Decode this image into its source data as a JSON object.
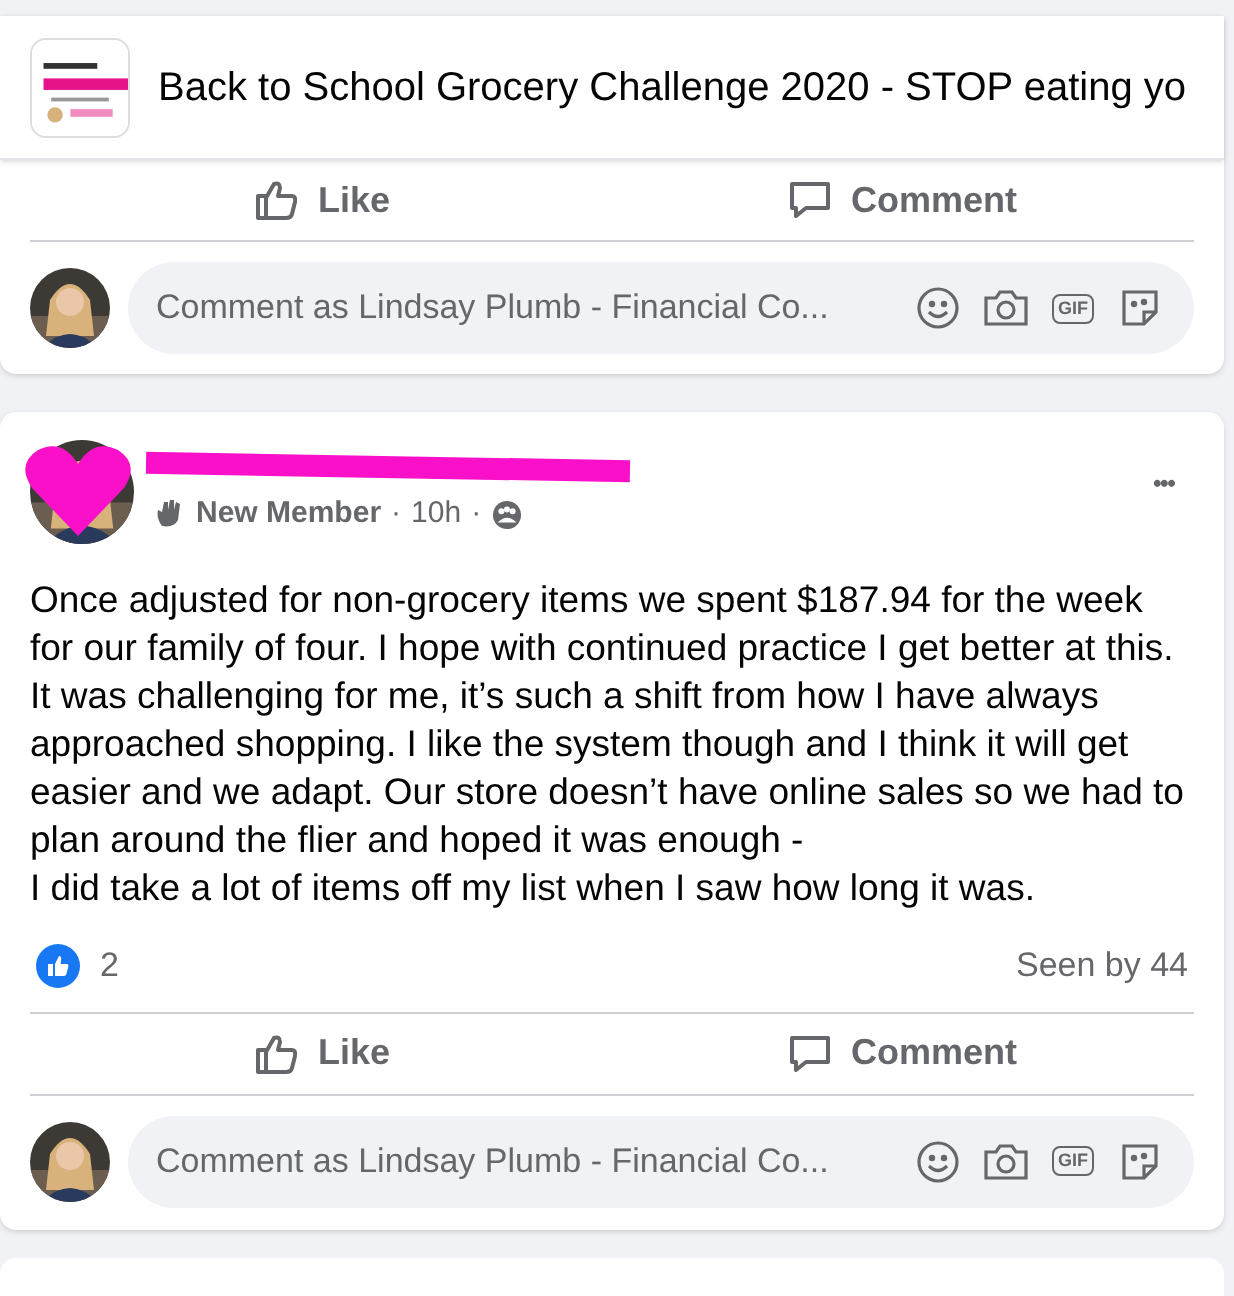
{
  "group_header": {
    "title": "Back to School Grocery Challenge 2020 - STOP eating yo"
  },
  "posts": [
    {
      "actions": [
        {
          "label": "Like",
          "kind": "like"
        },
        {
          "label": "Comment",
          "kind": "comment"
        }
      ],
      "comment_box": {
        "placeholder": "Comment as Lindsay Plumb - Financial Co...",
        "gif_label": "GIF"
      }
    },
    {
      "author": {
        "redacted": true,
        "badge": "New Member",
        "time": "10h",
        "separator": "·"
      },
      "more": "•••",
      "body": "Once adjusted for non-grocery items we spent $187.94 for the week for our family of four. I hope with continued practice I get better at this. It was challenging for me, it’s such a shift from how I have always approached shopping. I like the system though and I think it will get easier and we adapt.  Our store doesn’t have online sales so we had to plan around the flier and hoped it was enough -\nI did take a lot of items off my list when I saw how long it was.",
      "reactions": {
        "count": "2",
        "seen": "Seen by 44"
      },
      "actions": [
        {
          "label": "Like",
          "kind": "like"
        },
        {
          "label": "Comment",
          "kind": "comment"
        }
      ],
      "comment_box": {
        "placeholder": "Comment as Lindsay Plumb - Financial Co...",
        "gif_label": "GIF"
      }
    }
  ]
}
